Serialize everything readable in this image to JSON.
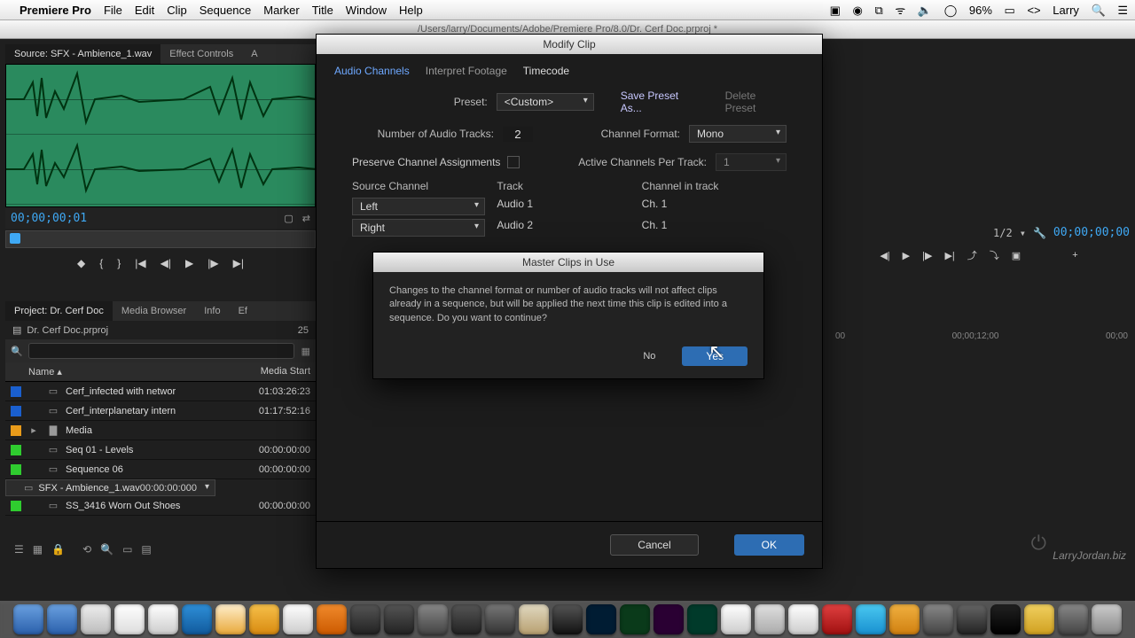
{
  "menubar": {
    "app": "Premiere Pro",
    "items": [
      "File",
      "Edit",
      "Clip",
      "Sequence",
      "Marker",
      "Title",
      "Window",
      "Help"
    ],
    "battery": "96%",
    "user": "Larry"
  },
  "document_path": "/Users/larry/Documents/Adobe/Premiere Pro/8.0/Dr. Cerf Doc.prproj *",
  "source": {
    "tabs": [
      "Source: SFX - Ambience_1.wav",
      "Effect Controls",
      "A"
    ],
    "timecode": "00;00;00;01"
  },
  "project": {
    "tabs": [
      "Project: Dr. Cerf Doc",
      "Media Browser",
      "Info",
      "Ef"
    ],
    "project_file": "Dr. Cerf Doc.prproj",
    "item_count": "25",
    "headers": {
      "name": "Name",
      "media_start": "Media Start"
    },
    "items": [
      {
        "color": "#1a5fce",
        "name": "Cerf_infected with networ",
        "ms": "01:03:26:23"
      },
      {
        "color": "#1a5fce",
        "name": "Cerf_interplanetary intern",
        "ms": "01:17:52:16"
      },
      {
        "color": "#e89b1a",
        "name": "Media",
        "ms": "",
        "folder": true
      },
      {
        "color": "#2fcc2f",
        "name": "Seq 01 - Levels",
        "ms": "00:00:00:00"
      },
      {
        "color": "#2fcc2f",
        "name": "Sequence 06",
        "ms": "00:00:00:00"
      },
      {
        "color": "#2fcc2f",
        "name": "SFX - Ambience_1.wav",
        "ms": "00:00:00:000",
        "sel": true
      },
      {
        "color": "#2fcc2f",
        "name": "SS_3416 Worn Out Shoes",
        "ms": "00:00:00:00"
      }
    ]
  },
  "modify": {
    "title": "Modify Clip",
    "tabs": [
      "Audio Channels",
      "Interpret Footage",
      "Timecode"
    ],
    "preset_label": "Preset:",
    "preset_value": "<Custom>",
    "save_preset": "Save Preset As...",
    "delete_preset": "Delete Preset",
    "num_tracks_label": "Number of Audio Tracks:",
    "num_tracks": "2",
    "channel_format_label": "Channel Format:",
    "channel_format": "Mono",
    "preserve_label": "Preserve Channel Assignments",
    "active_label": "Active Channels Per Track:",
    "active": "1",
    "col_source": "Source Channel",
    "col_track": "Track",
    "col_cit": "Channel in track",
    "rows": [
      {
        "src": "Left",
        "trk": "Audio 1",
        "cit": "Ch. 1"
      },
      {
        "src": "Right",
        "trk": "Audio 2",
        "cit": "Ch. 1"
      }
    ],
    "cancel": "Cancel",
    "ok": "OK"
  },
  "confirm": {
    "title": "Master Clips in Use",
    "body": "Changes to the channel format or number of audio tracks will not affect clips already in a sequence, but will be applied the next time this clip is edited into a sequence. Do you want to continue?",
    "no": "No",
    "yes": "Yes"
  },
  "program": {
    "zoom": "1/2",
    "tc": "00;00;00;00",
    "ruler": [
      "00",
      "00;00;12;00",
      "00;00"
    ]
  },
  "watermark": "LarryJordan.biz"
}
